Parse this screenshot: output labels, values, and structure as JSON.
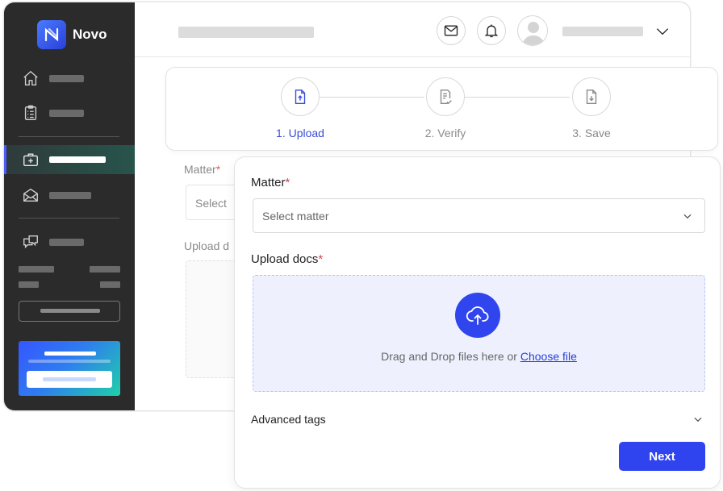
{
  "brand": {
    "name": "Novo",
    "accent": "#2f44ee"
  },
  "sidebar": {
    "items": [
      {
        "icon": "home-icon",
        "active": false
      },
      {
        "icon": "clipboard-icon",
        "active": false
      },
      {
        "icon": "briefcase-plus-icon",
        "active": true
      },
      {
        "icon": "open-envelope-icon",
        "active": false
      },
      {
        "icon": "chat-bubbles-icon",
        "active": false
      }
    ]
  },
  "header": {
    "icons": [
      "mail-icon",
      "bell-icon",
      "user-avatar-icon",
      "chevron-down-icon"
    ]
  },
  "back_form": {
    "matter_label": "Matter",
    "required_mark": "*",
    "select_placeholder": "Select",
    "upload_label": "Upload d"
  },
  "stepper": {
    "steps": [
      {
        "label": "1. Upload",
        "icon": "file-upload-icon",
        "active": true
      },
      {
        "label": "2. Verify",
        "icon": "file-check-icon",
        "active": false
      },
      {
        "label": "3. Save",
        "icon": "file-download-icon",
        "active": false
      }
    ]
  },
  "modal": {
    "matter_label": "Matter",
    "required_mark": "*",
    "matter_placeholder": "Select matter",
    "upload_label": "Upload docs",
    "drop_text": "Drag and Drop files here or",
    "choose_file": "Choose file",
    "advanced_tags": "Advanced tags",
    "next_button": "Next"
  }
}
